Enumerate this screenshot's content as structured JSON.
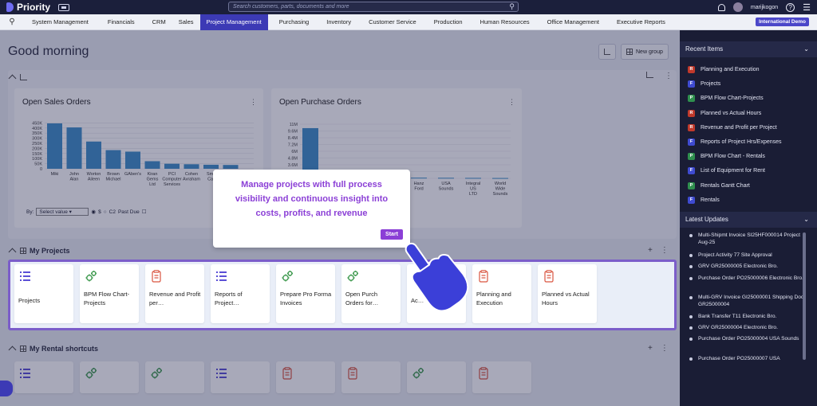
{
  "app": {
    "name": "Priority"
  },
  "search": {
    "placeholder": "Search customers, parts, documents and more"
  },
  "user": {
    "name": "marijkogon"
  },
  "menu": {
    "items": [
      "System Management",
      "Financials",
      "CRM",
      "Sales",
      "Project Management",
      "Purchasing",
      "Inventory",
      "Customer Service",
      "Production",
      "Human Resources",
      "Office Management",
      "Executive Reports"
    ],
    "active": "Project Management",
    "badge": "International Demo"
  },
  "greeting": "Good morning",
  "buttons": {
    "new_group": "New group"
  },
  "charts": {
    "sales_title": "Open Sales Orders",
    "purchase_title": "Open Purchase Orders",
    "filter": {
      "by_label": "By:",
      "select_value": "Select value",
      "opt1": "$",
      "opt2": "C2",
      "past_due": "Past Due"
    }
  },
  "chart_data": [
    {
      "type": "bar",
      "title": "Open Sales Orders",
      "categories": [
        "Miki",
        "John Alan",
        "Worton Aileen",
        "Brown Michael",
        "GAben's",
        "Kiran Gems Ltd",
        "PCI Computer Services",
        "Cohen Avraham",
        "Smit Car",
        ""
      ],
      "values": [
        450000,
        410000,
        270000,
        185000,
        170000,
        75000,
        50000,
        45000,
        40000,
        38000
      ],
      "yticks": [
        "0",
        "50K",
        "100K",
        "150K",
        "200K",
        "250K",
        "300K",
        "350K",
        "400K",
        "450K"
      ],
      "ylim": [
        0,
        450000
      ]
    },
    {
      "type": "bar",
      "title": "Open Purchase Orders",
      "categories": [
        "",
        "",
        "",
        "",
        "Hanz Ford",
        "USA Sounds",
        "Integral US LTD",
        "World Wide Sounds"
      ],
      "values": [
        9500000,
        250000,
        200000,
        150000,
        120000,
        100000,
        80000,
        60000
      ],
      "yticks": [
        "1.2M",
        "2.4M",
        "3.6M",
        "4.8M",
        "6M",
        "7.2M",
        "8.4M",
        "9.6M",
        "11M"
      ],
      "ylim": [
        0,
        11000000
      ]
    }
  ],
  "sections": {
    "projects": "My Projects",
    "rentals": "My Rental shortcuts"
  },
  "project_tiles": [
    {
      "label": "Projects",
      "icon": "list-icon"
    },
    {
      "label": "BPM Flow Chart-Projects",
      "icon": "gears-icon"
    },
    {
      "label": "Revenue and Profit per…",
      "icon": "report-icon"
    },
    {
      "label": "Reports of Project…",
      "icon": "list-icon"
    },
    {
      "label": "Prepare Pro Forma Invoices",
      "icon": "gears-icon"
    },
    {
      "label": "Open Purch Orders for…",
      "icon": "gears-icon"
    },
    {
      "label": "Ac…",
      "icon": "gears-icon"
    },
    {
      "label": "Planning and Execution",
      "icon": "report-icon"
    },
    {
      "label": "Planned vs Actual Hours",
      "icon": "report-icon"
    }
  ],
  "rental_tiles": [
    {
      "icon": "list-icon"
    },
    {
      "icon": "gears-icon"
    },
    {
      "icon": "gears-icon"
    },
    {
      "icon": "list-icon"
    },
    {
      "icon": "report-icon"
    },
    {
      "icon": "report-icon"
    },
    {
      "icon": "gears-icon"
    },
    {
      "icon": "report-icon"
    }
  ],
  "tooltip": {
    "text": "Manage projects with full process visibility and continuous insight into costs, profits, and revenue",
    "button": "Start"
  },
  "sidebar": {
    "recent_title": "Recent Items",
    "recent": [
      {
        "label": "Planning and Execution",
        "type": "R",
        "color": "#c0392b"
      },
      {
        "label": "Projects",
        "type": "F",
        "color": "#3f4bd1"
      },
      {
        "label": "BPM Flow Chart-Projects",
        "type": "P",
        "color": "#2f8f4e"
      },
      {
        "label": "Planned vs Actual Hours",
        "type": "R",
        "color": "#c0392b"
      },
      {
        "label": "Revenue and Profit per Project",
        "type": "R",
        "color": "#c0392b"
      },
      {
        "label": "Reports of Project Hrs/Expenses",
        "type": "F",
        "color": "#3f4bd1"
      },
      {
        "label": "BPM Flow Chart - Rentals",
        "type": "P",
        "color": "#2f8f4e"
      },
      {
        "label": "List of Equipment for Rent",
        "type": "F",
        "color": "#3f4bd1"
      },
      {
        "label": "Rentals Gantt Chart",
        "type": "P",
        "color": "#2f8f4e"
      },
      {
        "label": "Rentals",
        "type": "F",
        "color": "#3f4bd1"
      }
    ],
    "updates_title": "Latest Updates",
    "updates": [
      "Multi-Shipmt Invoice SI25HF000014 Project Aug-25",
      "Project Activity 77 Site Approval",
      "GRV GR25000005 Electronic Bro.",
      "Purchase Order PO25000006 Electronic Bro.",
      "Multi-GRV Invoice GI25000001 Shipping Doc. GR25000004",
      "Bank Transfer T11 Electronic Bro.",
      "GRV GR25000004 Electronic Bro.",
      "Purchase Order PO25000004 USA Sounds",
      "Purchase Order PO25000007 USA"
    ]
  }
}
